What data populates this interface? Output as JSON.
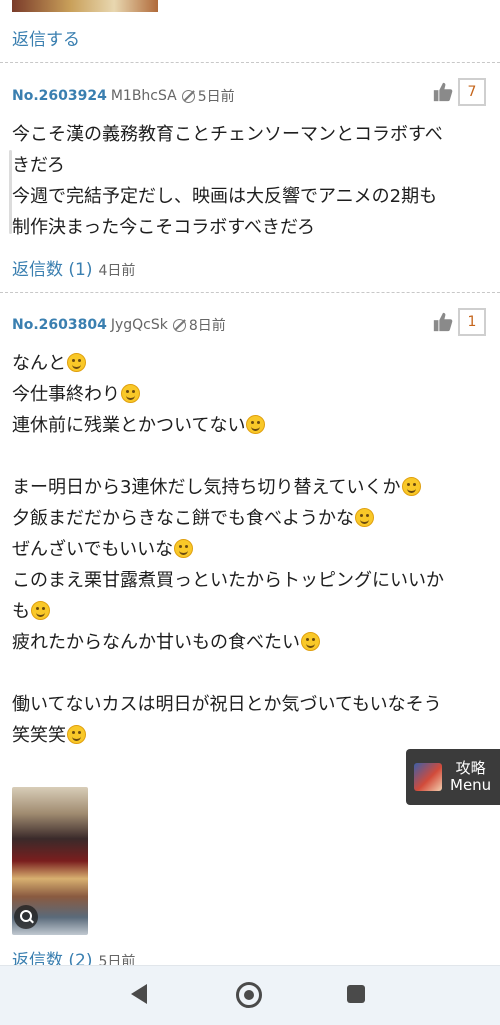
{
  "top": {
    "reply_label": "返信する"
  },
  "posts": [
    {
      "no": "No.2603924",
      "id": "M1BhcSA",
      "time": "5日前",
      "likes": "7",
      "lines": [
        "今こそ漢の義務教育ことチェンソーマンとコラボすべ",
        "きだろ",
        "今週で完結予定だし、映画は大反響でアニメの2期も",
        "制作決まった今こそコラボすべきだろ"
      ],
      "replies_label": "返信数 (1)",
      "replies_age": "4日前"
    },
    {
      "no": "No.2603804",
      "id": "JygQcSk",
      "time": "8日前",
      "likes": "1",
      "lines": [
        "なんと",
        "今仕事終わり",
        "連休前に残業とかついてない",
        "",
        "まー明日から3連休だし気持ち切り替えていくか",
        "夕飯まだだからきなこ餅でも食べようかな",
        "ぜんざいでもいいな",
        "このまえ栗甘露煮買っといたからトッピングにいいか",
        "も",
        "疲れたからなんか甘いもの食べたい",
        "",
        "働いてないカスは明日が祝日とか気づいてもいなそう",
        "笑笑笑"
      ],
      "replies_label": "返信数 (2)",
      "replies_age": "5日前"
    }
  ],
  "float_menu": {
    "line1": "攻略",
    "line2": "Menu"
  }
}
